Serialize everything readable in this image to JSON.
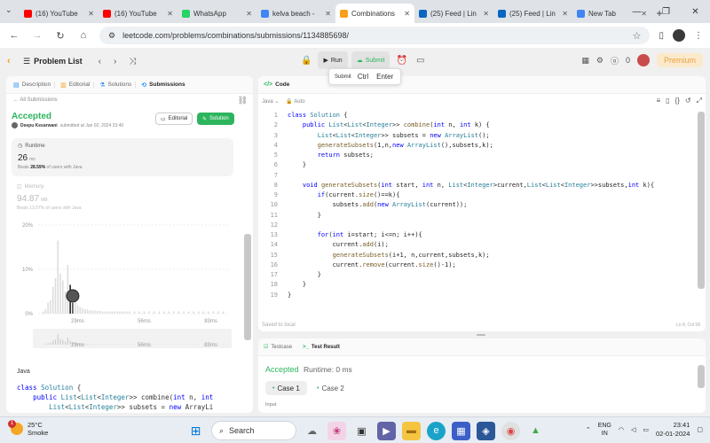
{
  "browser": {
    "tabs": [
      {
        "label": "(16) YouTube",
        "color": "#ff0000",
        "active": false
      },
      {
        "label": "(16) YouTube",
        "color": "#ff0000",
        "active": false
      },
      {
        "label": "WhatsApp",
        "color": "#25d366",
        "active": false
      },
      {
        "label": "kelva beach - ",
        "color": "#4285f4",
        "active": false
      },
      {
        "label": "Combinations",
        "color": "#f89f1b",
        "active": true
      },
      {
        "label": "(25) Feed | Lin",
        "color": "#0a66c2",
        "active": false
      },
      {
        "label": "(25) Feed | Lin",
        "color": "#0a66c2",
        "active": false
      },
      {
        "label": "New Tab",
        "color": "#4285f4",
        "active": false
      }
    ],
    "url": "leetcode.com/problems/combinations/submissions/1134885698/"
  },
  "lc_nav": {
    "problem_list": "Problem List",
    "run": "Run",
    "submit": "Submit",
    "streak": "0",
    "premium": "Premium"
  },
  "tooltip": {
    "label": "Submit",
    "key1": "Ctrl",
    "key2": "Enter"
  },
  "left": {
    "tabs": {
      "description": "Description",
      "editorial": "Editorial",
      "solutions": "Solutions",
      "submissions": "Submissions"
    },
    "all_submissions": "← All Submissions",
    "status": "Accepted",
    "user": "Deepu Kesarwani",
    "submitted_at": "submitted at Jan 02, 2024 23:40",
    "editorial_btn": "Editorial",
    "solution_btn": "Solution",
    "runtime": {
      "label": "Runtime",
      "value": "26",
      "unit": "ms",
      "beats_pct": "28.59%",
      "beats_suffix": "of users with Java"
    },
    "memory": {
      "label": "Memory",
      "value": "94.87",
      "unit": "MB",
      "beats": "Beats 13.07% of users with Java"
    },
    "language": "Java"
  },
  "chart_data": {
    "type": "bar",
    "title": "",
    "xlabel": "",
    "ylabel": "",
    "yticks": [
      "20%",
      "10%",
      "0%"
    ],
    "ylim": [
      0,
      20
    ],
    "xticks": [
      "29ms",
      "56ms",
      "83ms"
    ],
    "x": [
      15,
      16,
      17,
      18,
      19,
      20,
      21,
      22,
      23,
      24,
      25,
      26,
      27,
      28,
      29,
      30,
      31,
      32,
      33,
      34,
      35,
      36,
      37,
      38,
      39,
      40,
      41,
      42,
      43,
      44,
      45,
      46,
      47,
      48,
      49,
      50,
      52,
      54,
      56,
      58,
      60,
      62,
      64,
      66,
      68,
      70,
      72,
      74,
      76,
      78,
      80,
      82,
      84,
      86,
      88
    ],
    "values": [
      0.5,
      1,
      2.5,
      3,
      6,
      8,
      16.5,
      9,
      7.5,
      5,
      11,
      6.5,
      3.5,
      2.5,
      2,
      1.5,
      1.2,
      1,
      0.9,
      0.8,
      0.7,
      0.7,
      0.6,
      0.6,
      0.5,
      0.5,
      0.5,
      0.5,
      0.5,
      0.5,
      0.5,
      0.5,
      0.5,
      0.5,
      0.5,
      0.5,
      0.5,
      0.5,
      0.5,
      0.5,
      0.5,
      0.5,
      0.5,
      0.5,
      0.5,
      0.5,
      0.5,
      0.5,
      0.5,
      0.5,
      0.5,
      0.5,
      0.5,
      0.5,
      0.5
    ],
    "highlight_x": 26,
    "xrange": [
      13,
      90
    ],
    "navigator_ticks": [
      "29ms",
      "56ms",
      "83ms"
    ]
  },
  "code_preview": [
    "class Solution {",
    "    public List<List<Integer>> combine(int n, int",
    "        List<List<Integer>> subsets = new ArrayLi"
  ],
  "editor": {
    "title": "Code",
    "language": "Java",
    "mode": "Auto",
    "saved": "Saved to local",
    "position": "Ln 8, Col 58",
    "lines": [
      "class Solution {",
      "    public List<List<Integer>> combine(int n, int k) {",
      "        List<List<Integer>> subsets = new ArrayList();",
      "        generateSubsets(1,n,new ArrayList(),subsets,k);",
      "        return subsets;",
      "    }",
      "",
      "    void generateSubsets(int start, int n, List<Integer>current,List<List<Integer>>subsets,int k){",
      "        if(current.size()==k){",
      "            subsets.add(new ArrayList(current));",
      "        }",
      "",
      "        for(int i=start; i<=n; i++){",
      "            current.add(i);",
      "            generateSubsets(i+1, n,current,subsets,k);",
      "            current.remove(current.size()-1);",
      "        }",
      "    }",
      "}"
    ]
  },
  "test": {
    "testcase_tab": "Testcase",
    "result_tab": "Test Result",
    "status": "Accepted",
    "runtime": "Runtime: 0 ms",
    "case1": "Case 1",
    "case2": "Case 2",
    "input_label": "Input"
  },
  "taskbar": {
    "weather_badge": "1",
    "temp": "25°C",
    "condition": "Smoke",
    "search": "Search",
    "lang1": "ENG",
    "lang2": "IN",
    "time": "23:41",
    "date": "02-01-2024"
  }
}
